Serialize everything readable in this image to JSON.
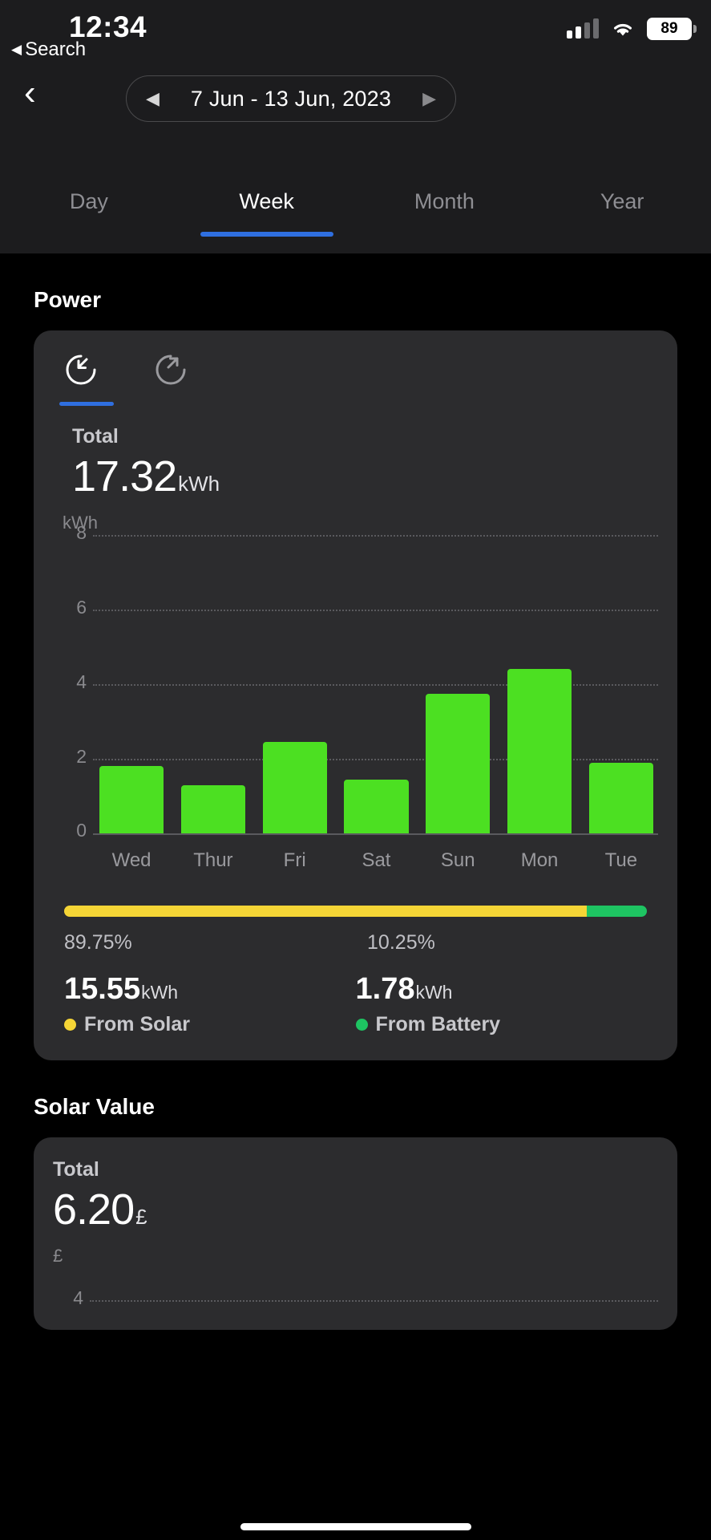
{
  "status_bar": {
    "time": "12:34",
    "back_to_search_label": "Search",
    "back_triangle": "◀",
    "battery_percent": "89",
    "cell_icon": "cellular-signal-icon",
    "wifi_icon": "wifi-icon",
    "battery_icon": "battery-icon"
  },
  "nav": {
    "back_icon": "‹",
    "prev_icon": "◀",
    "next_icon": "▶",
    "date_range": "7 Jun - 13 Jun, 2023"
  },
  "range_tabs": {
    "items": [
      {
        "label": "Day",
        "active": false
      },
      {
        "label": "Week",
        "active": true
      },
      {
        "label": "Month",
        "active": false
      },
      {
        "label": "Year",
        "active": false
      }
    ],
    "accent": "#2f6fe0"
  },
  "power_section": {
    "title": "Power",
    "icons": [
      {
        "name": "energy-import-icon",
        "selected": true
      },
      {
        "name": "energy-export-icon",
        "selected": false
      }
    ],
    "total_label": "Total",
    "total_value": "17.32",
    "total_unit": "kWh",
    "split": {
      "left_pct": "89.75%",
      "right_pct": "10.25%",
      "left_value": "15.55",
      "left_unit": "kWh",
      "left_legend": "From Solar",
      "left_color": "#f5d536",
      "right_value": "1.78",
      "right_unit": "kWh",
      "right_legend": "From Battery",
      "right_color": "#1ec462",
      "left_fraction": 89.75,
      "right_fraction": 10.25
    }
  },
  "solar_value_section": {
    "title": "Solar Value",
    "total_label": "Total",
    "total_value": "6.20",
    "total_unit": "£",
    "axis_unit": "£",
    "axis_tick": "4"
  },
  "chart_data": {
    "type": "bar",
    "title": "Power",
    "xlabel": "",
    "ylabel": "kWh",
    "ylim": [
      0,
      8
    ],
    "yticks": [
      0,
      2,
      4,
      6,
      8
    ],
    "ytick_labels": [
      "0",
      "2",
      "4",
      "6",
      "8"
    ],
    "grid": true,
    "legend_position": "below",
    "bar_color": "#4ce022",
    "categories": [
      "Wed",
      "Thur",
      "Fri",
      "Sat",
      "Sun",
      "Mon",
      "Tue"
    ],
    "values": [
      1.8,
      1.3,
      2.45,
      1.45,
      3.75,
      4.4,
      1.9
    ],
    "total": 17.32,
    "total_unit": "kWh"
  }
}
